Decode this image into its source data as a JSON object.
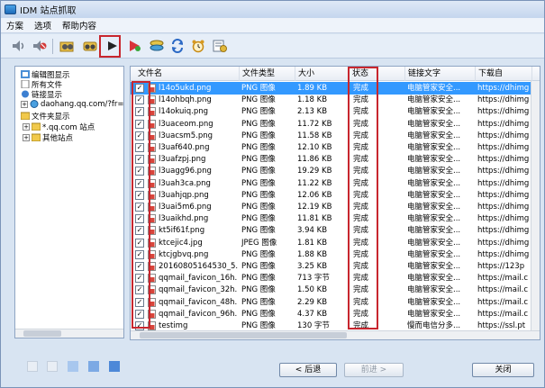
{
  "window": {
    "title": "IDM 站点抓取"
  },
  "menu": [
    "方案",
    "选项",
    "帮助内容"
  ],
  "toolbar": {
    "buttons": [
      "speaker-icon",
      "speaker-mute-icon",
      "folder-binoculars-icon",
      "binoculars-icon",
      "play-flag-icon",
      "play-green-icon",
      "stack-icon",
      "refresh-icon",
      "alarm-clock-icon",
      "list-settings-icon"
    ]
  },
  "tree": {
    "items": [
      {
        "label": "编辑图显示",
        "indent": 0
      },
      {
        "label": "所有文件",
        "indent": 0
      },
      {
        "label": "链接显示",
        "indent": 0
      },
      {
        "label": "daohang.qq.com/?fr=",
        "indent": 1
      },
      {
        "label": "文件夹显示",
        "indent": 0
      },
      {
        "label": "*.qq.com 站点",
        "indent": 1
      },
      {
        "label": "其他站点",
        "indent": 1
      }
    ]
  },
  "list": {
    "columns": [
      "文件名",
      "文件类型",
      "大小",
      "状态",
      "链接文字",
      "下载自"
    ],
    "rows": [
      {
        "name": "l14o5ukd.png",
        "type": "PNG 图像",
        "size": "1.89 KB",
        "status": "完成",
        "link": "电脑管家安全...",
        "from": "https://dhimg",
        "selected": true
      },
      {
        "name": "l14ohbqh.png",
        "type": "PNG 图像",
        "size": "1.18 KB",
        "status": "完成",
        "link": "电脑管家安全...",
        "from": "https://dhimg"
      },
      {
        "name": "l14okuiq.png",
        "type": "PNG 图像",
        "size": "2.13 KB",
        "status": "完成",
        "link": "电脑管家安全...",
        "from": "https://dhimg"
      },
      {
        "name": "l3uaceom.png",
        "type": "PNG 图像",
        "size": "11.72 KB",
        "status": "完成",
        "link": "电脑管家安全...",
        "from": "https://dhimg"
      },
      {
        "name": "l3uacsm5.png",
        "type": "PNG 图像",
        "size": "11.58 KB",
        "status": "完成",
        "link": "电脑管家安全...",
        "from": "https://dhimg"
      },
      {
        "name": "l3uaf640.png",
        "type": "PNG 图像",
        "size": "12.10 KB",
        "status": "完成",
        "link": "电脑管家安全...",
        "from": "https://dhimg"
      },
      {
        "name": "l3uafzpj.png",
        "type": "PNG 图像",
        "size": "11.86 KB",
        "status": "完成",
        "link": "电脑管家安全...",
        "from": "https://dhimg"
      },
      {
        "name": "l3uagg96.png",
        "type": "PNG 图像",
        "size": "19.29 KB",
        "status": "完成",
        "link": "电脑管家安全...",
        "from": "https://dhimg"
      },
      {
        "name": "l3uah3ca.png",
        "type": "PNG 图像",
        "size": "11.22 KB",
        "status": "完成",
        "link": "电脑管家安全...",
        "from": "https://dhimg"
      },
      {
        "name": "l3uahjqp.png",
        "type": "PNG 图像",
        "size": "12.06 KB",
        "status": "完成",
        "link": "电脑管家安全...",
        "from": "https://dhimg"
      },
      {
        "name": "l3uai5m6.png",
        "type": "PNG 图像",
        "size": "12.19 KB",
        "status": "完成",
        "link": "电脑管家安全...",
        "from": "https://dhimg"
      },
      {
        "name": "l3uaikhd.png",
        "type": "PNG 图像",
        "size": "11.81 KB",
        "status": "完成",
        "link": "电脑管家安全...",
        "from": "https://dhimg"
      },
      {
        "name": "kt5if61f.png",
        "type": "PNG 图像",
        "size": "3.94 KB",
        "status": "完成",
        "link": "电脑管家安全...",
        "from": "https://dhimg"
      },
      {
        "name": "ktcejic4.jpg",
        "type": "JPEG 图像",
        "size": "1.81 KB",
        "status": "完成",
        "link": "电脑管家安全...",
        "from": "https://dhimg"
      },
      {
        "name": "ktcjgbvq.png",
        "type": "PNG 图像",
        "size": "1.88 KB",
        "status": "完成",
        "link": "电脑管家安全...",
        "from": "https://dhimg"
      },
      {
        "name": "20160805164530_5...",
        "type": "PNG 图像",
        "size": "3.25 KB",
        "status": "完成",
        "link": "电脑管家安全...",
        "from": "https://123p"
      },
      {
        "name": "qqmail_favicon_16h...",
        "type": "PNG 图像",
        "size": "713 字节",
        "status": "完成",
        "link": "电脑管家安全...",
        "from": "https://mail.c"
      },
      {
        "name": "qqmail_favicon_32h...",
        "type": "PNG 图像",
        "size": "1.50 KB",
        "status": "完成",
        "link": "电脑管家安全...",
        "from": "https://mail.c"
      },
      {
        "name": "qqmail_favicon_48h...",
        "type": "PNG 图像",
        "size": "2.29 KB",
        "status": "完成",
        "link": "电脑管家安全...",
        "from": "https://mail.c"
      },
      {
        "name": "qqmail_favicon_96h...",
        "type": "PNG 图像",
        "size": "4.37 KB",
        "status": "完成",
        "link": "电脑管家安全...",
        "from": "https://mail.c"
      },
      {
        "name": "testimg",
        "type": "PNG 图像",
        "size": "130 字节",
        "status": "完成",
        "link": "慢而电信分多...",
        "from": "https://ssl.pt"
      }
    ]
  },
  "footer": {
    "back_label": "< 后退",
    "next_label": "前进 >",
    "close_label": "关闭"
  },
  "colors": {
    "highlight": "#c8262e",
    "selection": "#3399ff",
    "window_bg": "#d8e4f2"
  }
}
